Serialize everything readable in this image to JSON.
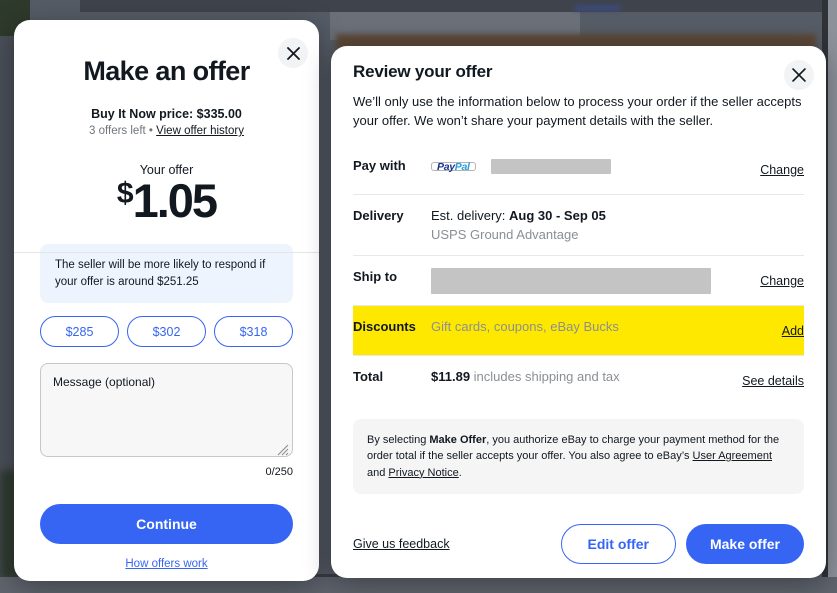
{
  "background": {
    "page_color": "#565c66"
  },
  "offer_modal": {
    "close_icon": "close-icon",
    "title": "Make an offer",
    "buy_it_now_label": "Buy It Now price: $335.00",
    "offers_left": "3 offers left",
    "separator": "•",
    "offer_history_link": "View offer history",
    "your_offer_label": "Your offer",
    "currency_symbol": "$",
    "offer_value": "1.05",
    "tip_text": "The seller will be more likely to respond if your offer is around $251.25",
    "quick_offers": [
      {
        "label": "$285"
      },
      {
        "label": "$302"
      },
      {
        "label": "$318"
      }
    ],
    "message_placeholder": "Message (optional)",
    "message_value": "",
    "char_counter": "0/250",
    "continue_label": "Continue",
    "how_offers_work_label": "How offers work",
    "accent_color": "#3665f3",
    "tip_bg_color": "#edf4fd"
  },
  "review_modal": {
    "close_icon": "close-icon",
    "title": "Review your offer",
    "subtitle": "We’ll only use the information below to process your order if the seller accepts your offer. We won’t share your payment details with the seller.",
    "rows": [
      {
        "label": "Pay with",
        "payment_brand_part1": "Pay",
        "payment_brand_part2": "Pal",
        "value_redacted": true,
        "action": "Change"
      },
      {
        "label": "Delivery",
        "est_prefix": "Est. delivery: ",
        "est_dates": "Aug 30 - Sep 05",
        "carrier": "USPS Ground Advantage",
        "action": ""
      },
      {
        "label": "Ship to",
        "value_redacted": true,
        "action": "Change"
      },
      {
        "label": "Discounts",
        "value": "Gift cards, coupons, eBay Bucks",
        "action": "Add",
        "highlight_color": "#ffe800"
      },
      {
        "label": "Total",
        "amount": "$11.89",
        "amount_note": "includes shipping and tax",
        "action": "See details"
      }
    ],
    "legal": {
      "part1": "By selecting ",
      "bold1": "Make Offer",
      "part2": ", you authorize eBay to charge your payment method for the order total if the seller accepts your offer. You also agree to eBay’s ",
      "link1": "User Agreement",
      "part3": " and ",
      "link2": "Privacy Notice",
      "part4": "."
    },
    "footer": {
      "feedback_label": "Give us feedback",
      "edit_offer_label": "Edit offer",
      "make_offer_label": "Make offer"
    },
    "accent_color": "#3665f3"
  }
}
